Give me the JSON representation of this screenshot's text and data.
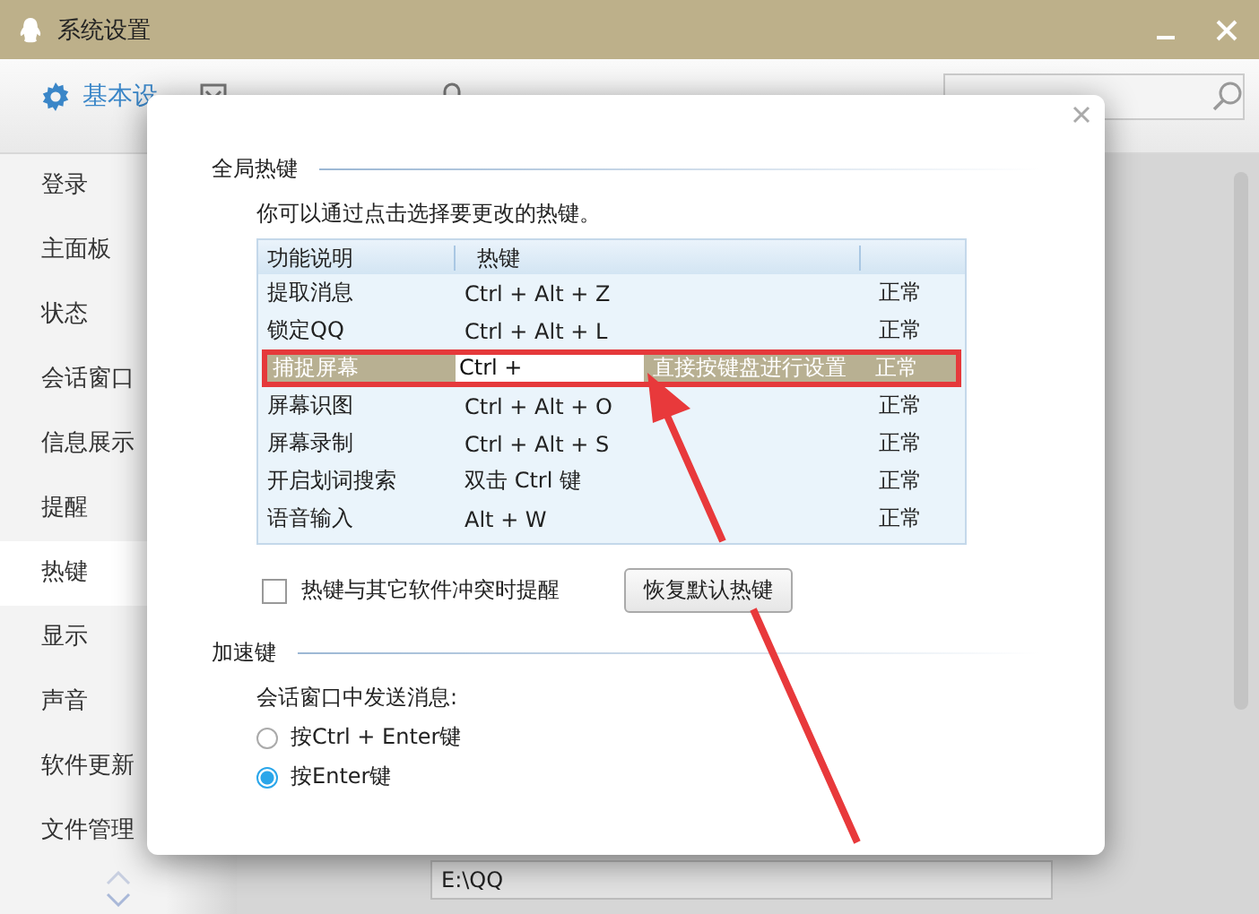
{
  "window": {
    "title": "系统设置"
  },
  "tabs": [
    {
      "label": "基本设",
      "selected": true
    }
  ],
  "sidebar": {
    "items": [
      {
        "label": "登录",
        "selected": false
      },
      {
        "label": "主面板",
        "selected": false
      },
      {
        "label": "状态",
        "selected": false
      },
      {
        "label": "会话窗口",
        "selected": false
      },
      {
        "label": "信息展示",
        "selected": false
      },
      {
        "label": "提醒",
        "selected": false
      },
      {
        "label": "热键",
        "selected": true
      },
      {
        "label": "显示",
        "selected": false
      },
      {
        "label": "声音",
        "selected": false
      },
      {
        "label": "软件更新",
        "selected": false
      },
      {
        "label": "文件管理",
        "selected": false
      }
    ]
  },
  "background_field": {
    "value": "E:\\QQ"
  },
  "dialog": {
    "global_hotkeys": {
      "title": "全局热键",
      "hint": "你可以通过点击选择要更改的热键。",
      "table": {
        "columns": [
          "功能说明",
          "热键"
        ],
        "rows": [
          {
            "function": "提取消息",
            "hotkey": "Ctrl + Alt + Z",
            "status": "正常",
            "selected": false
          },
          {
            "function": "锁定QQ",
            "hotkey": "Ctrl + Alt + L",
            "status": "正常",
            "selected": false
          },
          {
            "function": "捕捉屏幕",
            "hotkey": "Ctrl +",
            "hint": "直接按键盘进行设置",
            "status": "正常",
            "selected": true
          },
          {
            "function": "屏幕识图",
            "hotkey": "Ctrl + Alt + O",
            "status": "正常",
            "selected": false
          },
          {
            "function": "屏幕录制",
            "hotkey": "Ctrl + Alt + S",
            "status": "正常",
            "selected": false
          },
          {
            "function": "开启划词搜索",
            "hotkey": "双击 Ctrl 键",
            "status": "正常",
            "selected": false
          },
          {
            "function": "语音输入",
            "hotkey": "Alt + W",
            "status": "正常",
            "selected": false
          }
        ]
      },
      "conflict_checkbox": {
        "label": "热键与其它软件冲突时提醒",
        "checked": false
      },
      "restore_button": "恢复默认热键"
    },
    "accelerator": {
      "title": "加速键",
      "prompt": "会话窗口中发送消息:",
      "options": [
        {
          "label": "按Ctrl + Enter键",
          "selected": false
        },
        {
          "label": "按Enter键",
          "selected": true
        }
      ]
    }
  }
}
